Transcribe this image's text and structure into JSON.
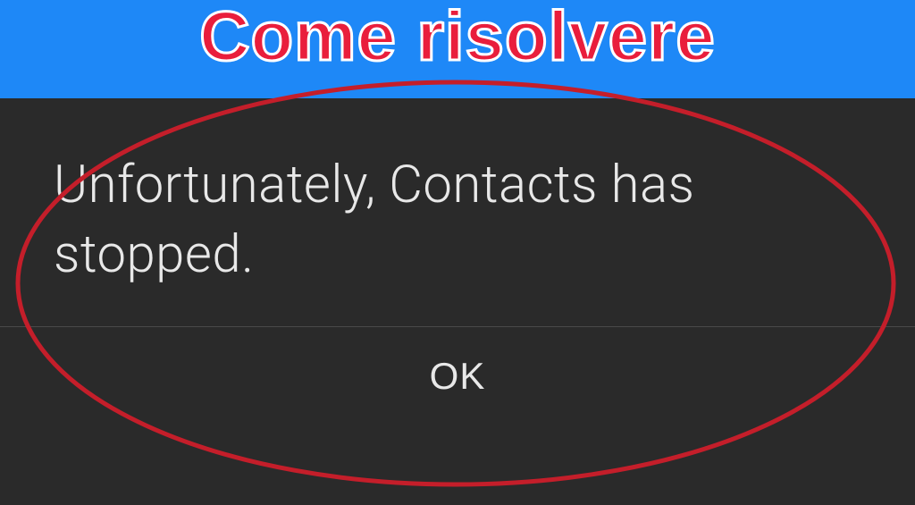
{
  "header": {
    "title": "Come risolvere"
  },
  "dialog": {
    "message": "Unfortunately, Contacts has stopped.",
    "ok_button": "OK"
  },
  "colors": {
    "banner_bg": "#1e88f7",
    "dialog_bg": "#2a2a2a",
    "title_color": "#e91e3c",
    "ellipse_stroke": "#c41e2a"
  }
}
